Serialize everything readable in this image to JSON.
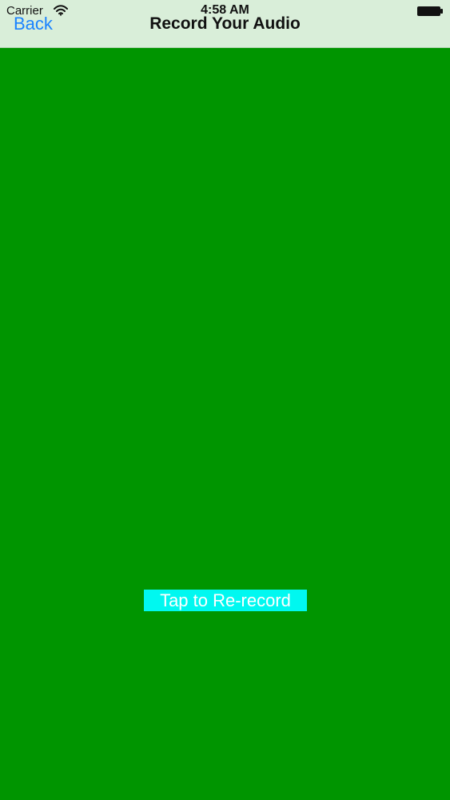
{
  "status_bar": {
    "carrier": "Carrier",
    "time": "4:58 AM",
    "wifi_icon": "wifi-icon",
    "battery_icon": "battery-icon"
  },
  "nav_bar": {
    "back_label": "Back",
    "title": "Record Your Audio"
  },
  "main": {
    "rerecord_label": "Tap to Re-record"
  },
  "colors": {
    "background": "#009500",
    "nav_bar": "#d9eed9",
    "back_link": "#1a83ff",
    "button_background": "#00f8f0",
    "button_text": "#ffffff"
  }
}
